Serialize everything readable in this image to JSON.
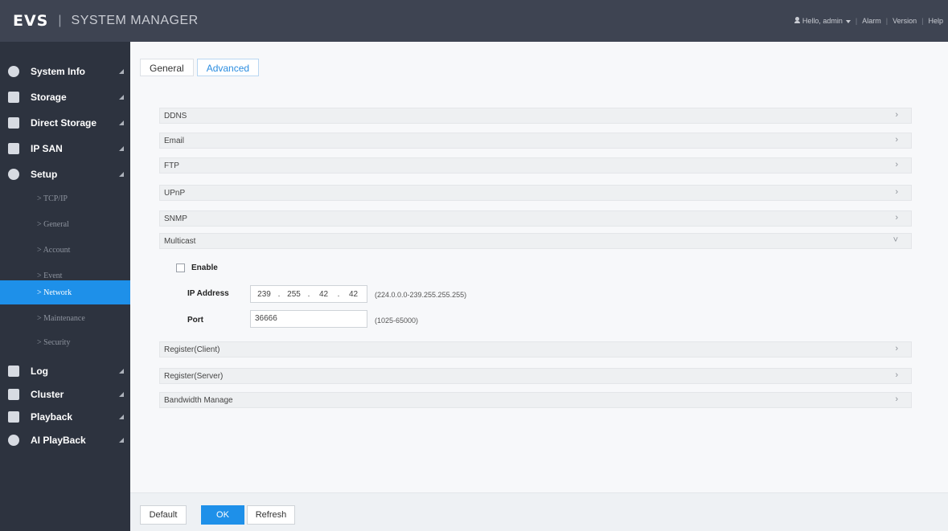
{
  "header": {
    "logo": "EVS",
    "title": "SYSTEM MANAGER",
    "user_greeting": "Hello, admin",
    "alarm": "Alarm",
    "version": "Version",
    "help": "Help"
  },
  "sidebar": {
    "items": [
      {
        "label": "System Info",
        "icon": "info-icon"
      },
      {
        "label": "Storage",
        "icon": "storage-icon"
      },
      {
        "label": "Direct Storage",
        "icon": "direct-storage-icon"
      },
      {
        "label": "IP SAN",
        "icon": "ip-san-icon"
      },
      {
        "label": "Setup",
        "icon": "gear-icon"
      },
      {
        "label": "Log",
        "icon": "log-icon"
      },
      {
        "label": "Cluster",
        "icon": "cluster-icon"
      },
      {
        "label": "Playback",
        "icon": "playback-icon"
      },
      {
        "label": "AI PlayBack",
        "icon": "ai-playback-icon"
      }
    ],
    "setup_sub": [
      {
        "label": "> TCP/IP"
      },
      {
        "label": "> General"
      },
      {
        "label": "> Account"
      },
      {
        "label": "> Event"
      },
      {
        "label": "> Network",
        "active": true
      },
      {
        "label": "> Maintenance"
      },
      {
        "label": "> Security"
      }
    ]
  },
  "tabs": [
    {
      "label": "General",
      "selected": false
    },
    {
      "label": "Advanced",
      "selected": true
    }
  ],
  "sections": [
    {
      "label": "DDNS",
      "state": "collapsed"
    },
    {
      "label": "Email",
      "state": "collapsed"
    },
    {
      "label": "FTP",
      "state": "collapsed"
    },
    {
      "label": "UPnP",
      "state": "collapsed"
    },
    {
      "label": "SNMP",
      "state": "collapsed"
    },
    {
      "label": "Multicast",
      "state": "expanded"
    },
    {
      "label": "Register(Client)",
      "state": "collapsed"
    },
    {
      "label": "Register(Server)",
      "state": "collapsed"
    },
    {
      "label": "Bandwidth Manage",
      "state": "collapsed"
    }
  ],
  "multicast": {
    "enable_label": "Enable",
    "enable_checked": false,
    "ip_label": "IP Address",
    "ip": [
      "239",
      "255",
      "42",
      "42"
    ],
    "ip_range": "(224.0.0.0-239.255.255.255)",
    "port_label": "Port",
    "port": "36666",
    "port_range": "(1025-65000)"
  },
  "buttons": {
    "default": "Default",
    "ok": "OK",
    "refresh": "Refresh"
  },
  "colors": {
    "topbar": "#3e4452",
    "sidebar": "#2d333f",
    "accent": "#1e90e9"
  }
}
